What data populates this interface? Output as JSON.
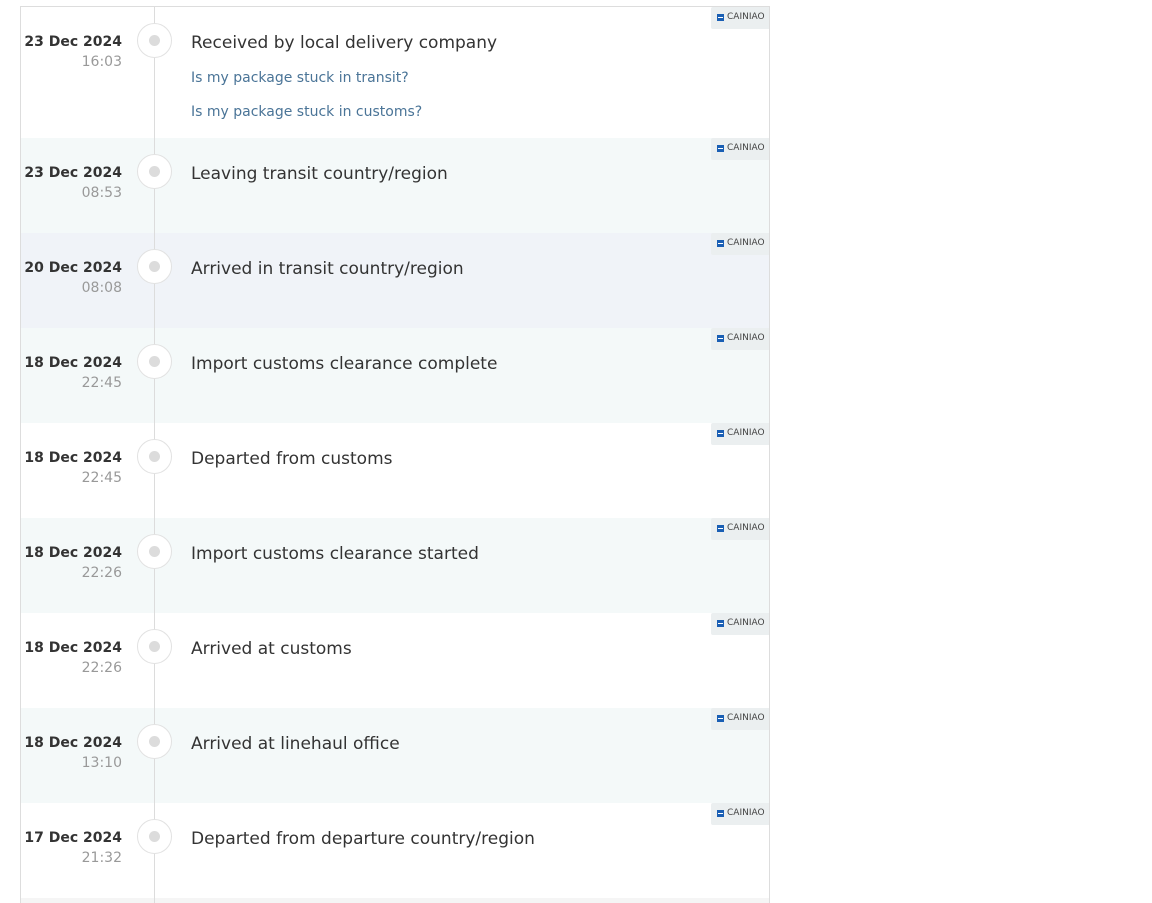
{
  "events": [
    {
      "date": "23 Dec 2024",
      "time": "16:03",
      "status": "Received by local delivery company",
      "carrier": "CAINIAO",
      "links": [
        "Is my package stuck in transit?",
        "Is my package stuck in customs?"
      ]
    },
    {
      "date": "23 Dec 2024",
      "time": "08:53",
      "status": "Leaving transit country/region",
      "carrier": "CAINIAO"
    },
    {
      "date": "20 Dec 2024",
      "time": "08:08",
      "status": "Arrived in transit country/region",
      "carrier": "CAINIAO"
    },
    {
      "date": "18 Dec 2024",
      "time": "22:45",
      "status": "Import customs clearance complete",
      "carrier": "CAINIAO"
    },
    {
      "date": "18 Dec 2024",
      "time": "22:45",
      "status": "Departed from customs",
      "carrier": "CAINIAO"
    },
    {
      "date": "18 Dec 2024",
      "time": "22:26",
      "status": "Import customs clearance started",
      "carrier": "CAINIAO"
    },
    {
      "date": "18 Dec 2024",
      "time": "22:26",
      "status": "Arrived at customs",
      "carrier": "CAINIAO"
    },
    {
      "date": "18 Dec 2024",
      "time": "13:10",
      "status": "Arrived at linehaul office",
      "carrier": "CAINIAO"
    },
    {
      "date": "17 Dec 2024",
      "time": "21:32",
      "status": "Departed from departure country/region",
      "carrier": "CAINIAO"
    }
  ]
}
